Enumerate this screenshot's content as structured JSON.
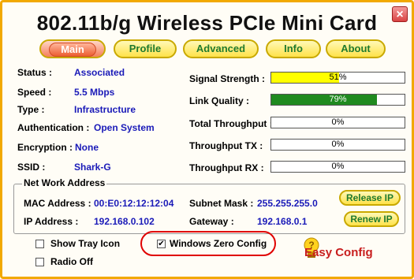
{
  "window": {
    "title": "802.11b/g Wireless PCIe Mini Card",
    "close_icon": "close-icon",
    "border_color": "#f2a900"
  },
  "tabs": [
    {
      "label": "Main",
      "active": true
    },
    {
      "label": "Profile",
      "active": false
    },
    {
      "label": "Advanced",
      "active": false
    },
    {
      "label": "Info",
      "active": false
    },
    {
      "label": "About",
      "active": false
    }
  ],
  "status": {
    "status_label": "Status :",
    "status_value": "Associated",
    "speed_label": "Speed :",
    "speed_value": "5.5 Mbps",
    "type_label": "Type :",
    "type_value": "Infrastructure",
    "auth_label": "Authentication :",
    "auth_value": "Open System",
    "enc_label": "Encryption :",
    "enc_value": "None",
    "ssid_label": "SSID :",
    "ssid_value": "Shark-G"
  },
  "meters": {
    "signal": {
      "label": "Signal Strength :",
      "text": "51%",
      "level": 0.51,
      "color": "#ffff00"
    },
    "quality": {
      "label": "Link Quality :",
      "text": "79%",
      "level": 0.79,
      "color": "#1f8a1f"
    },
    "total": {
      "label": "Total Throughput :",
      "text": "0%",
      "level": 0
    },
    "tx": {
      "label": "Throughput TX :",
      "text": "0%",
      "level": 0
    },
    "rx": {
      "label": "Throughput RX :",
      "text": "0%",
      "level": 0
    }
  },
  "network": {
    "group_title": "Net Work Address",
    "mac_label": "MAC Address :",
    "mac_value": "00:E0:12:12:12:04",
    "ip_label": "IP Address :",
    "ip_value": "192.168.0.102",
    "mask_label": "Subnet Mask :",
    "mask_value": "255.255.255.0",
    "gw_label": "Gateway :",
    "gw_value": "192.168.0.1",
    "release_label": "Release IP",
    "renew_label": "Renew IP"
  },
  "options": {
    "tray_label": "Show Tray Icon",
    "tray_checked": false,
    "radio_label": "Radio Off",
    "radio_checked": false,
    "wzc_label": "Windows Zero Config",
    "wzc_checked": true,
    "wzc_mark": "✔"
  },
  "easy_config": {
    "label": "Easy Config",
    "icon": "lightbulb-icon"
  }
}
